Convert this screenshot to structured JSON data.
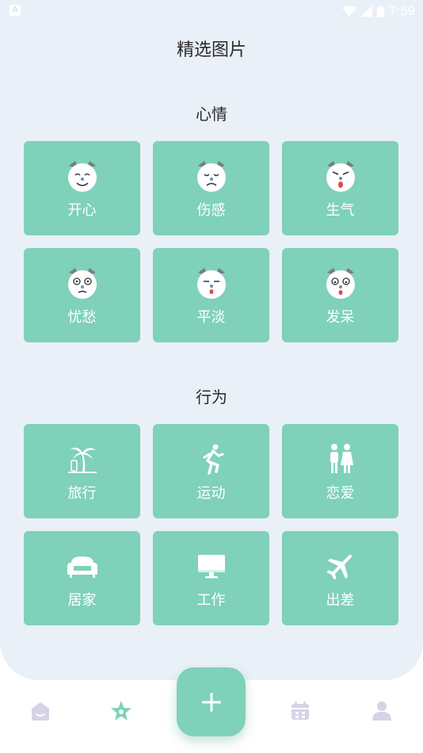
{
  "status_bar": {
    "time": "7:59"
  },
  "page": {
    "title": "精选图片"
  },
  "sections": {
    "mood": {
      "title": "心情",
      "items": [
        {
          "label": "开心",
          "icon": "cat-happy-icon"
        },
        {
          "label": "伤感",
          "icon": "cat-sad-icon"
        },
        {
          "label": "生气",
          "icon": "cat-angry-icon"
        },
        {
          "label": "忧愁",
          "icon": "cat-worried-icon"
        },
        {
          "label": "平淡",
          "icon": "cat-calm-icon"
        },
        {
          "label": "发呆",
          "icon": "cat-daze-icon"
        }
      ]
    },
    "behavior": {
      "title": "行为",
      "items": [
        {
          "label": "旅行",
          "icon": "palm-tree-icon"
        },
        {
          "label": "运动",
          "icon": "running-icon"
        },
        {
          "label": "恋爱",
          "icon": "couple-icon"
        },
        {
          "label": "居家",
          "icon": "sofa-icon"
        },
        {
          "label": "工作",
          "icon": "monitor-icon"
        },
        {
          "label": "出差",
          "icon": "airplane-icon"
        }
      ]
    }
  },
  "tabbar": {
    "items": [
      "home-icon",
      "star-icon",
      "add-icon",
      "calendar-icon",
      "profile-icon"
    ],
    "active": "star-icon",
    "active_color": "#7fd1b9",
    "inactive_color": "#d6d3e6"
  },
  "colors": {
    "accent": "#7fd1b9",
    "background": "#eaf0f8"
  }
}
